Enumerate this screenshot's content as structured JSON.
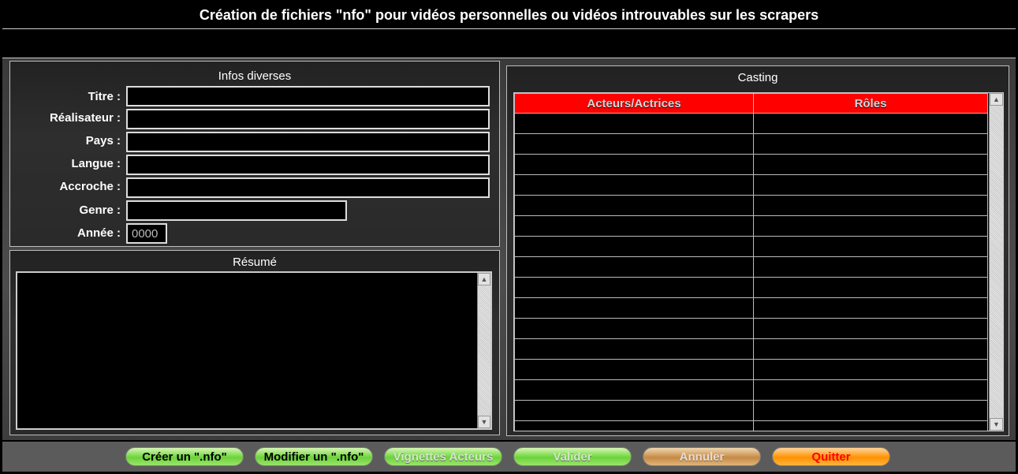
{
  "window": {
    "title": "Création de fichiers \"nfo\" pour vidéos personnelles ou vidéos introuvables sur les scrapers"
  },
  "infos": {
    "section_title": "Infos diverses",
    "fields": {
      "titre_label": "Titre :",
      "titre_value": "",
      "realisateur_label": "Réalisateur :",
      "realisateur_value": "",
      "pays_label": "Pays :",
      "pays_value": "",
      "langue_label": "Langue :",
      "langue_value": "",
      "accroche_label": "Accroche :",
      "accroche_value": "",
      "genre_label": "Genre :",
      "genre_value": "",
      "annee_label": "Année :",
      "annee_value": "0000"
    }
  },
  "resume": {
    "section_title": "Résumé",
    "text": ""
  },
  "casting": {
    "section_title": "Casting",
    "columns": [
      "Acteurs/Actrices",
      "Rôles"
    ],
    "header_color": "#ff0000",
    "rows": [
      [
        "",
        ""
      ],
      [
        "",
        ""
      ],
      [
        "",
        ""
      ],
      [
        "",
        ""
      ],
      [
        "",
        ""
      ],
      [
        "",
        ""
      ],
      [
        "",
        ""
      ],
      [
        "",
        ""
      ],
      [
        "",
        ""
      ],
      [
        "",
        ""
      ],
      [
        "",
        ""
      ],
      [
        "",
        ""
      ],
      [
        "",
        ""
      ],
      [
        "",
        ""
      ],
      [
        "",
        ""
      ],
      [
        "",
        ""
      ]
    ]
  },
  "buttons": {
    "creer": "Créer un \".nfo\"",
    "modifier": "Modifier un \".nfo\"",
    "vignettes": "Vignettes Acteurs",
    "valider": "Valider",
    "annuler": "Annuler",
    "quitter": "Quitter"
  },
  "icons": {
    "scroll_up": "scroll-up-arrow-icon",
    "scroll_down": "scroll-down-arrow-icon"
  }
}
